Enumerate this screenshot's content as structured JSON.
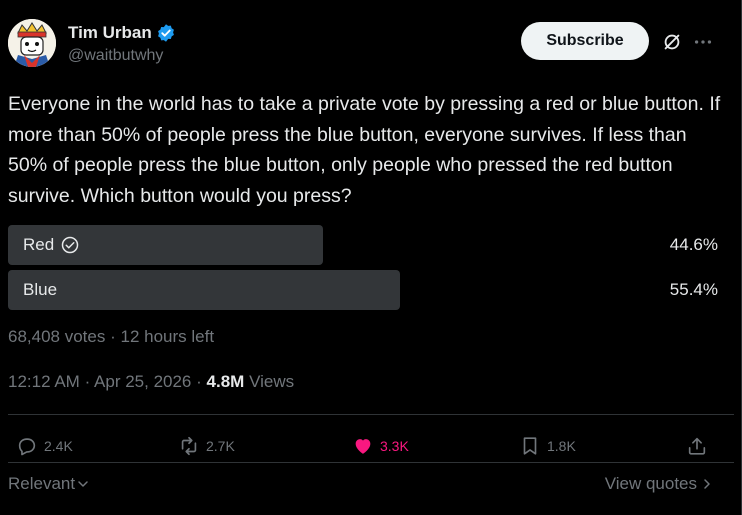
{
  "author": {
    "name": "Tim Urban",
    "handle": "@waitbutwhy",
    "verified": true,
    "verified_color": "#1d9bf0"
  },
  "header": {
    "subscribe_label": "Subscribe",
    "icons": [
      "grok-icon",
      "more-icon"
    ]
  },
  "tweet": {
    "text": "Everyone in the world has to take a private vote by pressing a red or blue button. If more than 50% of people press the blue button, everyone survives. If less than 50% of people press the blue button, only people who pressed the red button survive. Which button would you press?"
  },
  "poll": {
    "options": [
      {
        "label": "Red",
        "percent_text": "44.6%",
        "percent": 44.6,
        "selected": true
      },
      {
        "label": "Blue",
        "percent_text": "55.4%",
        "percent": 55.4,
        "selected": false
      }
    ],
    "votes": "68,408 votes",
    "time_left": "12 hours left",
    "separator": "·"
  },
  "meta": {
    "time": "12:12 AM",
    "date": "Apr 25, 2026",
    "views_count": "4.8M",
    "views_label": "Views",
    "separator": "·"
  },
  "actions": {
    "replies": "2.4K",
    "reposts": "2.7K",
    "likes": "3.3K",
    "bookmarks": "1.8K",
    "like_color": "#f91880"
  },
  "footer": {
    "sort_label": "Relevant",
    "view_quotes_label": "View quotes"
  }
}
